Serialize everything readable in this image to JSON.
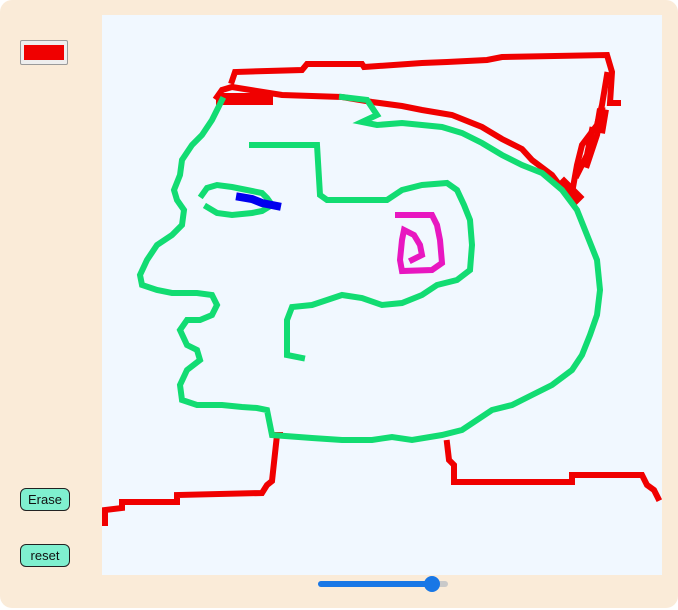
{
  "colors": {
    "frame": "#faebd8",
    "canvas": "#f1f8ff",
    "button": "#7ff0cf",
    "slider_accent": "#1877e6",
    "ink_red": "#f00000",
    "ink_green": "#12dc72",
    "ink_blue": "#0000ee",
    "ink_magenta": "#e817c0"
  },
  "toolbar": {
    "current_color": "#f00000",
    "erase_label": "Erase",
    "reset_label": "reset"
  },
  "brush_slider": {
    "value_fraction": 0.93
  },
  "drawing": {
    "description_icon": "pixel-face-drawing"
  }
}
